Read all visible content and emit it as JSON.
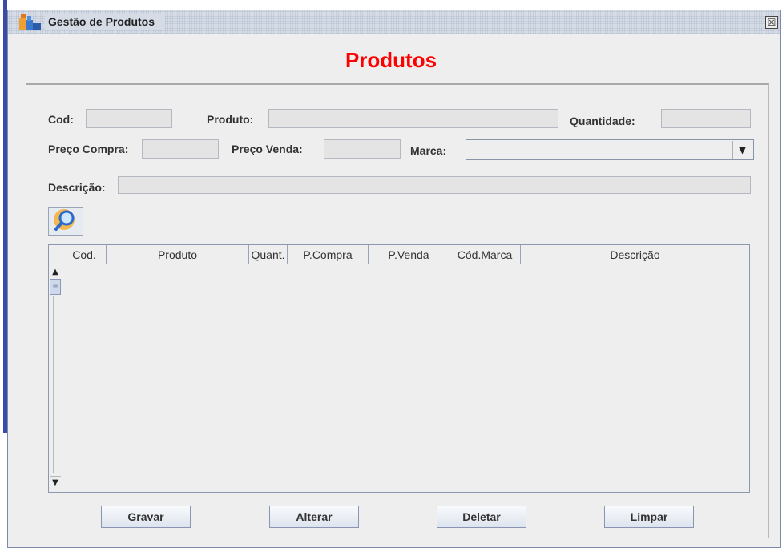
{
  "window": {
    "title": "Gestão de Produtos",
    "close_glyph": "☒"
  },
  "heading": "Produtos",
  "colors": {
    "heading": "#ff0000",
    "window_bg": "#eeeeee",
    "field_bg": "#e4e4e4"
  },
  "form": {
    "cod_label": "Cod:",
    "cod_value": "",
    "produto_label": "Produto:",
    "produto_value": "",
    "quantidade_label": "Quantidade:",
    "quantidade_value": "",
    "preco_compra_label": "Preço Compra:",
    "preco_compra_value": "",
    "preco_venda_label": "Preço Venda:",
    "preco_venda_value": "",
    "marca_label": "Marca:",
    "marca_selected": "",
    "descricao_label": "Descrição:",
    "descricao_value": ""
  },
  "icons": {
    "search": "magnifier-icon",
    "app": "app-icon",
    "combo_arrow": "▼",
    "scroll_up": "▲",
    "scroll_down": "▼",
    "scroll_grip": "≡"
  },
  "table": {
    "columns": [
      "Cod.",
      "Produto",
      "Quant.",
      "P.Compra",
      "P.Venda",
      "Cód.Marca",
      "Descrição"
    ],
    "rows": []
  },
  "buttons": {
    "gravar": "Gravar",
    "alterar": "Alterar",
    "deletar": "Deletar",
    "limpar": "Limpar"
  }
}
